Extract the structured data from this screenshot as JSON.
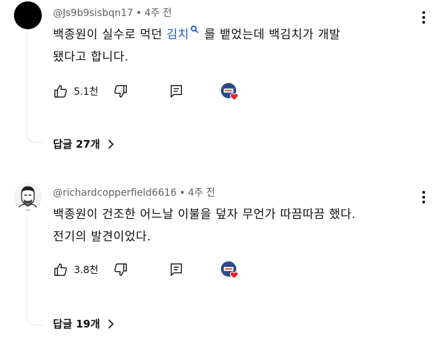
{
  "comments": [
    {
      "handle": "@Js9b9sisbqn17",
      "age": "4주 전",
      "text_before": "백종원이 실수로 먹던 ",
      "link_text": "김치",
      "text_after": "를 뱉었는데 백김치가 개발",
      "text_line2": "됐다고 합니다.",
      "likes": "5.1천",
      "replies": "답글 27개"
    },
    {
      "handle": "@richardcopperfield6616",
      "age": "4주 전",
      "text_line1": "백종원이 건조한 어느날 이불을 덮자 무언가 따끔따끔 했다.",
      "text_line2": "전기의 발견이었다.",
      "likes": "3.8천",
      "replies": "답글 19개"
    }
  ],
  "separator": "•",
  "colors": {
    "link": "#1a57c9",
    "meta": "#606060",
    "heart": "#e5222c",
    "badge": "#2d4a8a"
  }
}
